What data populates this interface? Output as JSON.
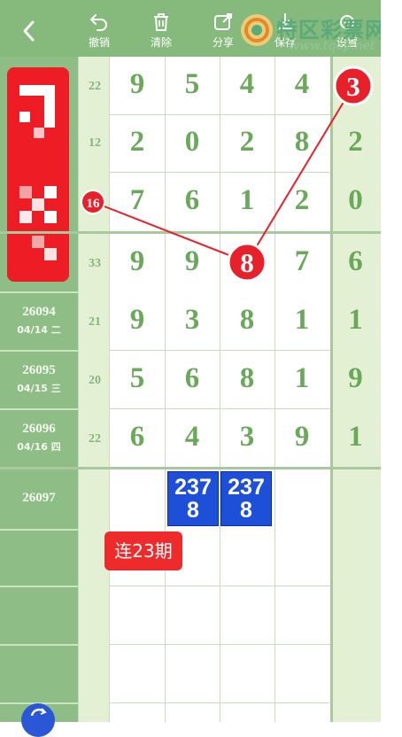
{
  "toolbar": {
    "undo": "撤销",
    "clear": "清除",
    "share": "分享",
    "save": "保存",
    "settings": "设置"
  },
  "watermark": {
    "title": "特区彩票网",
    "url": "www.tqcp.net"
  },
  "periods": [
    {
      "id": "",
      "date": ""
    },
    {
      "id": "",
      "date": ""
    },
    {
      "id": "",
      "date": ""
    },
    {
      "id": "",
      "date": ""
    },
    {
      "id": "26094",
      "date": "04/14 二"
    },
    {
      "id": "26095",
      "date": "04/15 三"
    },
    {
      "id": "26096",
      "date": "04/16 四"
    },
    {
      "id": "26097",
      "date": ""
    }
  ],
  "rows": [
    {
      "sum": "22",
      "digits": [
        "9",
        "5",
        "4",
        "4"
      ],
      "last": "3"
    },
    {
      "sum": "12",
      "digits": [
        "2",
        "0",
        "2",
        "8"
      ],
      "last": "2"
    },
    {
      "sum": "16",
      "digits": [
        "7",
        "6",
        "1",
        "2"
      ],
      "last": "0"
    },
    {
      "sum": "33",
      "digits": [
        "9",
        "9",
        "8",
        "7"
      ],
      "last": "6"
    },
    {
      "sum": "21",
      "digits": [
        "9",
        "3",
        "8",
        "1"
      ],
      "last": "1"
    },
    {
      "sum": "20",
      "digits": [
        "5",
        "6",
        "8",
        "1"
      ],
      "last": "9"
    },
    {
      "sum": "22",
      "digits": [
        "6",
        "4",
        "3",
        "9"
      ],
      "last": "1"
    }
  ],
  "picks": [
    {
      "top": "237",
      "bottom": "8"
    },
    {
      "top": "237",
      "bottom": "8"
    }
  ],
  "streak_label": "连23期",
  "colors": {
    "toolbar": "#86b97c",
    "highlight": "#e8202a",
    "pick": "#1e4fd8",
    "digit": "#6aa85a"
  }
}
